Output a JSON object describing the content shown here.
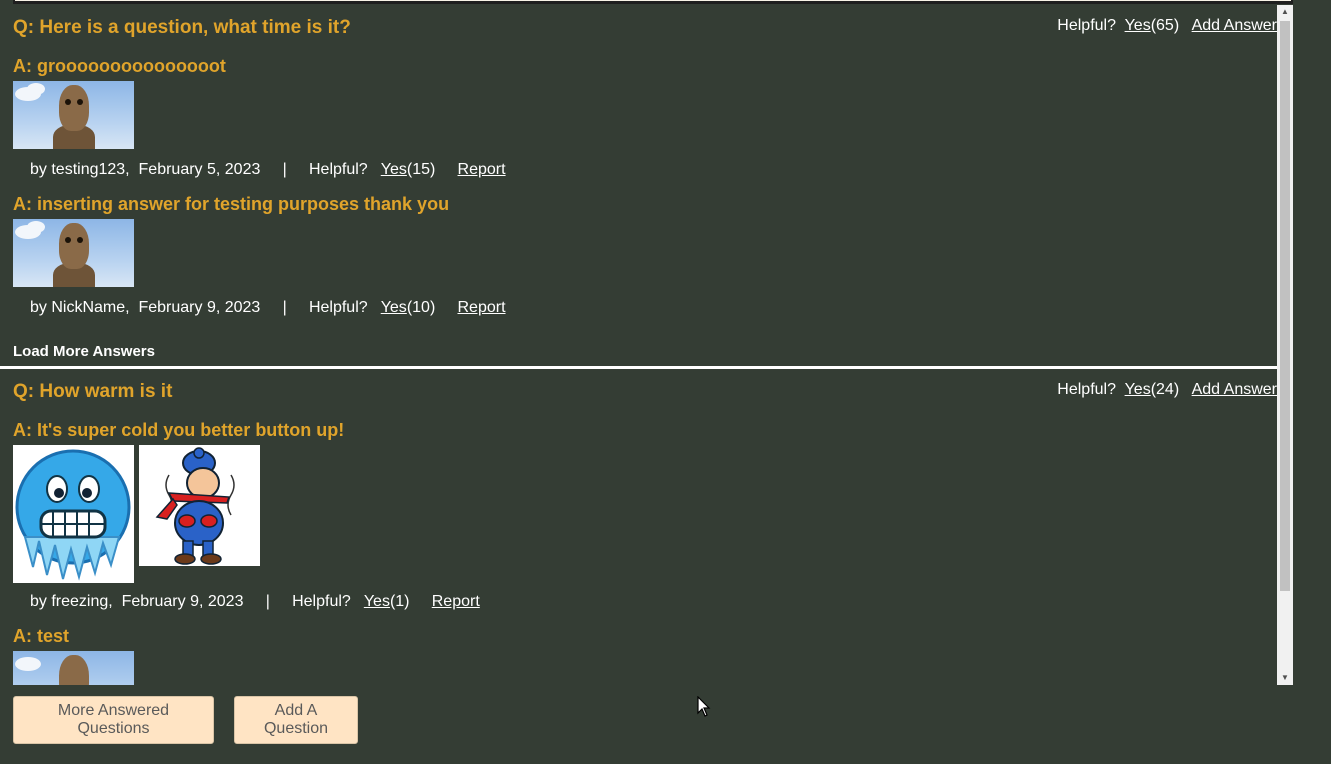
{
  "questions": [
    {
      "question": "Q: Here is a question, what time is it?",
      "helpful_label": "Helpful?",
      "yes_label": "Yes",
      "yes_count": "(65)",
      "add_answer_label": "Add Answer",
      "answers": [
        {
          "text": "A: grooooooooooooooot",
          "by": "by testing123,",
          "date": "February 5, 2023",
          "sep": "|",
          "helpful_label": "Helpful?",
          "yes_label": "Yes",
          "yes_count": "(15)",
          "report_label": "Report"
        },
        {
          "text": "A: inserting answer for testing purposes thank you",
          "by": "by NickName,",
          "date": "February 9, 2023",
          "sep": "|",
          "helpful_label": "Helpful?",
          "yes_label": "Yes",
          "yes_count": "(10)",
          "report_label": "Report"
        }
      ],
      "load_more_label": "Load More Answers"
    },
    {
      "question": "Q: How warm is it",
      "helpful_label": "Helpful?",
      "yes_label": "Yes",
      "yes_count": "(24)",
      "add_answer_label": "Add Answer",
      "answers": [
        {
          "text": "A: It's super cold you better button up!",
          "by": "by freezing,",
          "date": "February 9, 2023",
          "sep": "|",
          "helpful_label": "Helpful?",
          "yes_label": "Yes",
          "yes_count": "(1)",
          "report_label": "Report"
        },
        {
          "text": "A: test"
        }
      ]
    }
  ],
  "buttons": {
    "more_questions": "More Answered Questions",
    "add_question": "Add A Question"
  },
  "colors": {
    "background": "#343d34",
    "accent": "#e0a42b",
    "button_bg": "#ffe4c4"
  }
}
